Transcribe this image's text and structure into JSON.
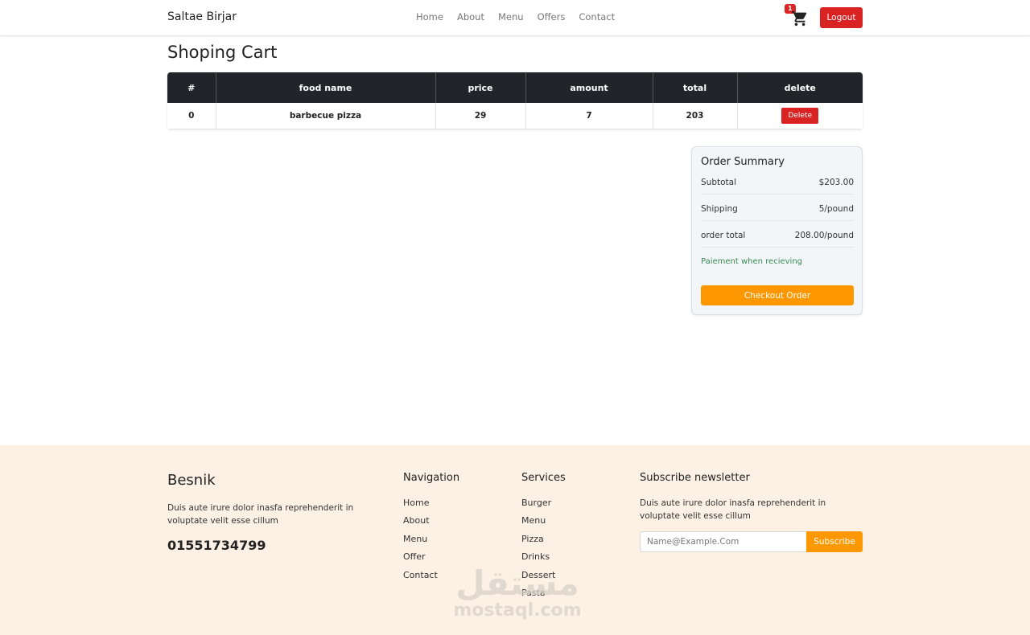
{
  "navbar": {
    "brand": "Saltae Birjar",
    "links": [
      "Home",
      "About",
      "Menu",
      "Offers",
      "Contact"
    ],
    "cart_count": "1",
    "logout_label": "Logout"
  },
  "page": {
    "title": "Shoping Cart"
  },
  "table": {
    "headers": [
      "#",
      "food name",
      "price",
      "amount",
      "total",
      "delete"
    ],
    "rows": [
      {
        "index": "0",
        "food_name": "barbecue pizza",
        "price": "29",
        "amount": "7",
        "total": "203",
        "delete_label": "Delete"
      }
    ]
  },
  "summary": {
    "title": "Order Summary",
    "rows": [
      {
        "label": "Subtotal",
        "value": "$203.00"
      },
      {
        "label": "Shipping",
        "value": "5/pound"
      },
      {
        "label": "order total",
        "value": "208.00/pound"
      }
    ],
    "payment_note": "Paiement when recieving",
    "checkout_label": "Checkout Order"
  },
  "footer": {
    "brand": "Besnik",
    "description": "Duis aute irure dolor inasfa reprehenderit in voluptate velit esse cillum",
    "phone": "01551734799",
    "navigation": {
      "title": "Navigation",
      "items": [
        "Home",
        "About",
        "Menu",
        "Offer",
        "Contact"
      ]
    },
    "services": {
      "title": "Services",
      "items": [
        "Burger",
        "Menu",
        "Pizza",
        "Drinks",
        "Dessert",
        "Pasta"
      ]
    },
    "newsletter": {
      "title": "Subscribe newsletter",
      "description": "Duis aute irure dolor inasfa reprehenderit in voluptate velit esse cillum",
      "placeholder": "Name@Example.Com",
      "button_label": "Subscribe"
    }
  },
  "watermark": {
    "arabic": "مستقل",
    "latin": "mostaql.com"
  },
  "colors": {
    "danger": "#d92323",
    "accent": "#ff9800",
    "header_dark": "#212529",
    "footer_bg": "#fcf1e4",
    "note_green": "#3c8a55"
  }
}
